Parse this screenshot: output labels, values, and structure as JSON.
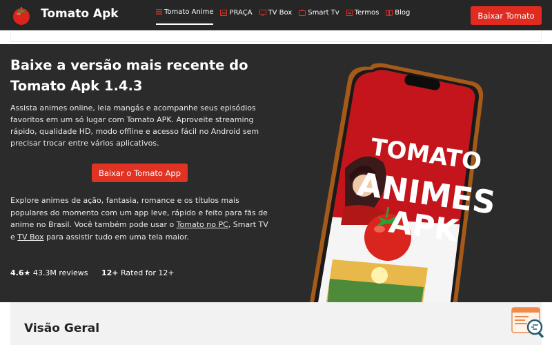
{
  "header": {
    "site_title": "Tomato Apk",
    "nav": [
      {
        "label": "Tomato Anime",
        "icon": "list-icon"
      },
      {
        "label": "PRAÇA",
        "icon": "image-icon"
      },
      {
        "label": "TV Box",
        "icon": "tv-icon"
      },
      {
        "label": "Smart Tv",
        "icon": "tv-icon"
      },
      {
        "label": "Termos",
        "icon": "document-icon"
      },
      {
        "label": "Blog",
        "icon": "book-icon"
      }
    ],
    "cta_label": "Baixar Tomato"
  },
  "hero": {
    "title": "Baixe a versão mais recente do Tomato Apk 1.4.3",
    "intro": "Assista animes online, leia mangás e acompanhe seus episódios favoritos em um só lugar com Tomato APK. Aproveite streaming rápido, qualidade HD, modo offline e acesso fácil no Android sem precisar trocar entre vários aplicativos.",
    "button_label": "Baixar o Tomato App",
    "body_part1": "Explore animes de ação, fantasia, romance e os títulos mais populares do momento com um app leve, rápido e feito para fãs de anime no Brasil. Você também pode usar o ",
    "link_pc": "Tomato no PC",
    "body_part2": ", Smart TV e ",
    "link_tvbox": "TV Box",
    "body_part3": " para assistir tudo em uma tela maior.",
    "rating_value": "4.6★",
    "rating_reviews": "43.3M reviews",
    "age_value": "12+",
    "age_label": "Rated for 12+",
    "phone_text": [
      "TOMATO",
      "ANIMES",
      "APK"
    ]
  },
  "overview": {
    "title": "Visão Geral"
  },
  "colors": {
    "accent": "#e02b20",
    "header_bg": "#262626",
    "hero_bg": "#2b2b2b",
    "phone_red": "#c4151c",
    "phone_frame": "#b5651d"
  }
}
